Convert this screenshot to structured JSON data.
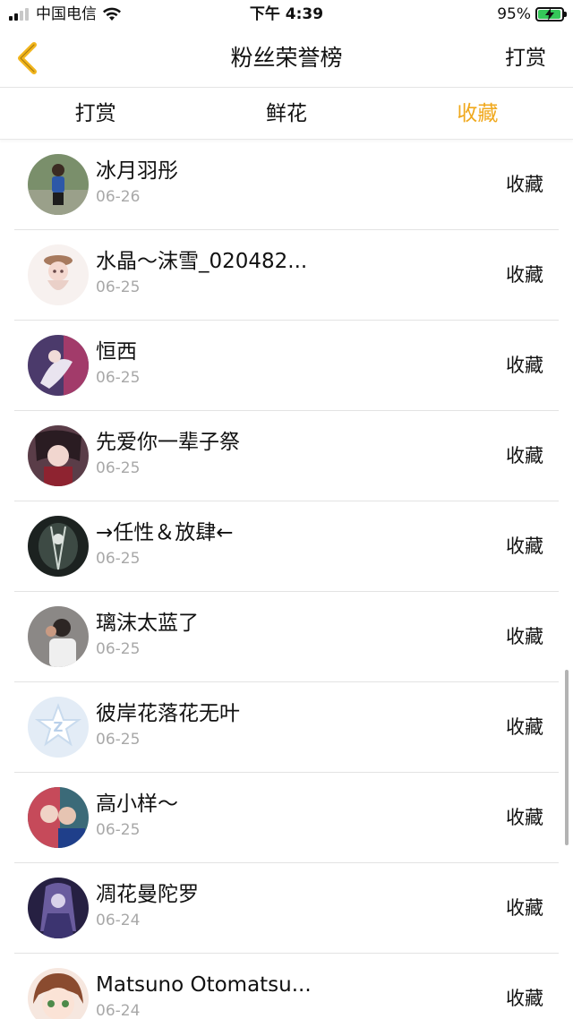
{
  "status_bar": {
    "carrier": "中国电信",
    "time": "下午 4:39",
    "battery": "95%",
    "battery_level": 0.95,
    "icons": [
      "signal-icon",
      "wifi-icon",
      "battery-charging-icon"
    ]
  },
  "nav": {
    "back_icon": "chevron-left-icon",
    "title": "粉丝荣誉榜",
    "action": "打赏"
  },
  "tabs": [
    {
      "label": "打赏",
      "active": false
    },
    {
      "label": "鲜花",
      "active": false
    },
    {
      "label": "收藏",
      "active": true
    }
  ],
  "colors": {
    "accent": "#f0a81c",
    "date": "#a8a8a8",
    "divider": "#e3e3e3"
  },
  "fans": [
    {
      "name": "冰月羽彤",
      "date": "06-26",
      "action": "收藏"
    },
    {
      "name": "水晶～沫雪_020482...",
      "date": "06-25",
      "action": "收藏"
    },
    {
      "name": "恒西",
      "date": "06-25",
      "action": "收藏"
    },
    {
      "name": "先爱你一辈子祭",
      "date": "06-25",
      "action": "收藏"
    },
    {
      "name": "→任性＆放肆←",
      "date": "06-25",
      "action": "收藏"
    },
    {
      "name": "璃沫太蓝了",
      "date": "06-25",
      "action": "收藏"
    },
    {
      "name": "彼岸花落花无叶",
      "date": "06-25",
      "action": "收藏"
    },
    {
      "name": "高小样～",
      "date": "06-25",
      "action": "收藏"
    },
    {
      "name": "凋花曼陀罗",
      "date": "06-24",
      "action": "收藏"
    },
    {
      "name": "Matsuno Otomatsu...",
      "date": "06-24",
      "action": "收藏"
    }
  ]
}
